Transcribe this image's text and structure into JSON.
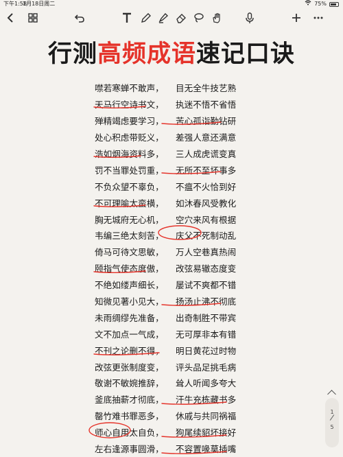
{
  "status": {
    "time": "下午1:58",
    "date": "1月18日周二",
    "battery": "75%",
    "battery_level": 0.75
  },
  "toolbar": {
    "icons": [
      "back-icon",
      "page-grid-icon",
      "undo-icon",
      "text-icon",
      "pen-icon",
      "highlighter-icon",
      "eraser-icon",
      "lasso-icon",
      "hand-icon",
      "microphone-icon",
      "add-icon",
      "more-icon"
    ]
  },
  "title": {
    "part1": "行测",
    "part2": "高频成语",
    "part3": "速记口诀"
  },
  "accent": "#e5332a",
  "rows": [
    {
      "l": "噤若寒蝉不敢声，",
      "r": "目无全牛技艺熟"
    },
    {
      "l": "天马行空诗书文，",
      "r": "执迷不悟不省悟"
    },
    {
      "l": "殚精竭虑要学习，",
      "r": "苦心孤诣勤钻研"
    },
    {
      "l": "处心积虑带贬义，",
      "r": "差强人意还满意"
    },
    {
      "l": "浩如烟海资料多，",
      "r": "三人成虎谎变真"
    },
    {
      "l": "罚不当罪处罚重，",
      "r": "无所不至坏事多"
    },
    {
      "l": "不负众望不辜负，",
      "r": "不瘟不火恰到好"
    },
    {
      "l": "不可理喻太蛮横，",
      "r": "如沐春风受教化"
    },
    {
      "l": "胸无城府无心机，",
      "r": "空穴来风有根据"
    },
    {
      "l": "韦编三绝太刻苦，",
      "r": "庆父不死制动乱"
    },
    {
      "l": "倚马可待文思敏，",
      "r": "万人空巷真热闹"
    },
    {
      "l": "颐指气使态度傲，",
      "r": "改弦易辙态度变"
    },
    {
      "l": "不绝如缕声细长，",
      "r": "屡试不爽都不错"
    },
    {
      "l": "知微见著小见大，",
      "r": "扬汤止沸不彻底"
    },
    {
      "l": "未雨绸缪先准备，",
      "r": "出奇制胜不带宾"
    },
    {
      "l": "文不加点一气成，",
      "r": "无可厚非本有错"
    },
    {
      "l": "不刊之论删不得，",
      "r": "明日黄花过时物"
    },
    {
      "l": "改弦更张制度变，",
      "r": "评头品足挑毛病"
    },
    {
      "l": "敬谢不敏婉推辞，",
      "r": "耸人听闻多夸大"
    },
    {
      "l": "釜底抽薪才彻底，",
      "r": "汗牛充栋藏书多"
    },
    {
      "l": "罄竹难书罪恶多，",
      "r": "休戚与共同祸福"
    },
    {
      "l": "师心自用太自负，",
      "r": "狗尾续貂坏接好"
    },
    {
      "l": "左右逢源事圆滑，",
      "r": "不容置喙莫插嘴"
    }
  ],
  "page": {
    "current": "1",
    "total": "5"
  }
}
